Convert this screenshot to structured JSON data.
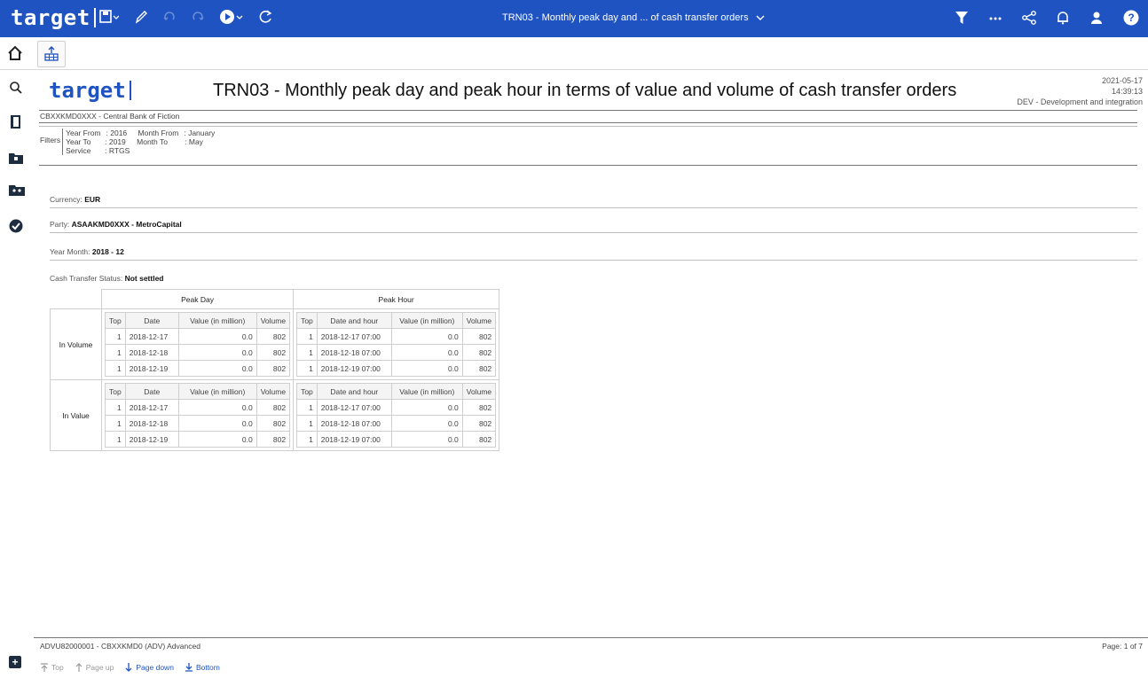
{
  "topbar": {
    "logo": "target",
    "title": "TRN03 - Monthly peak day and ... of cash transfer orders",
    "colors": {
      "bar": "#1f53c1"
    }
  },
  "report": {
    "logo": "target",
    "title": "TRN03 - Monthly peak day and peak hour in terms of value and volume of cash transfer orders",
    "date": "2021-05-17",
    "time": "14:39:13",
    "environment": "DEV - Development and integration",
    "bank": "CBXXKMD0XXX - Central Bank of Fiction",
    "filters": {
      "label": "Filters",
      "rows": [
        {
          "k1": "Year From",
          "v1": ": 2016",
          "k2": "Month From",
          "v2": ": January"
        },
        {
          "k1": "Year To",
          "v1": ": 2019",
          "k2": "Month To",
          "v2": ": May"
        },
        {
          "k1": "Service",
          "v1": ": RTGS",
          "k2": "",
          "v2": ""
        }
      ]
    },
    "currency": {
      "label": "Currency: ",
      "value": "EUR"
    },
    "party": {
      "label": "Party: ",
      "value": "ASAAKMD0XXX - MetroCapital"
    },
    "year_month": {
      "label": "Year Month: ",
      "value": "2018 - 12"
    },
    "status": {
      "label": "Cash Transfer Status: ",
      "value": "Not settled"
    }
  },
  "table": {
    "group_headers": [
      "Peak Day",
      "Peak Hour"
    ],
    "day_columns": [
      "Top",
      "Date",
      "Value (in million)",
      "Volume"
    ],
    "hour_columns": [
      "Top",
      "Date and hour",
      "Value (in million)",
      "Volume"
    ],
    "blocks": [
      {
        "label": "In Volume",
        "day_rows": [
          [
            "1",
            "2018-12-17",
            "0.0",
            "802"
          ],
          [
            "1",
            "2018-12-18",
            "0.0",
            "802"
          ],
          [
            "1",
            "2018-12-19",
            "0.0",
            "802"
          ]
        ],
        "hour_rows": [
          [
            "1",
            "2018-12-17 07:00",
            "0.0",
            "802"
          ],
          [
            "1",
            "2018-12-18 07:00",
            "0.0",
            "802"
          ],
          [
            "1",
            "2018-12-19 07:00",
            "0.0",
            "802"
          ]
        ]
      },
      {
        "label": "In Value",
        "day_rows": [
          [
            "1",
            "2018-12-17",
            "0.0",
            "802"
          ],
          [
            "1",
            "2018-12-18",
            "0.0",
            "802"
          ],
          [
            "1",
            "2018-12-19",
            "0.0",
            "802"
          ]
        ],
        "hour_rows": [
          [
            "1",
            "2018-12-17 07:00",
            "0.0",
            "802"
          ],
          [
            "1",
            "2018-12-18 07:00",
            "0.0",
            "802"
          ],
          [
            "1",
            "2018-12-19 07:00",
            "0.0",
            "802"
          ]
        ]
      }
    ]
  },
  "footer": {
    "user": "ADVU82000001 - CBXXKMD0 (ADV) Advanced",
    "page": "Page: 1 of 7",
    "nav": {
      "top": "Top",
      "page_up": "Page up",
      "page_down": "Page down",
      "bottom": "Bottom"
    }
  },
  "icons": [
    "save-icon",
    "pencil-icon",
    "undo-icon",
    "redo-icon",
    "run-icon",
    "refresh-icon",
    "filter-icon",
    "more-icon",
    "share-icon",
    "bell-icon",
    "user-icon",
    "help-icon",
    "home-icon",
    "report-icon",
    "search-icon",
    "book-icon",
    "folder-icon",
    "team-folder-icon",
    "check-icon",
    "add-icon"
  ]
}
